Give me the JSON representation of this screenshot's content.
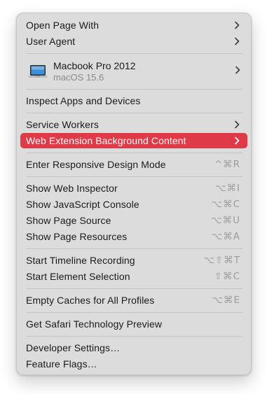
{
  "menu": {
    "open_page_with": "Open Page With",
    "user_agent": "User Agent",
    "device": {
      "name": "Macbook Pro 2012",
      "os": "macOS 15.6"
    },
    "inspect_apps": "Inspect Apps and Devices",
    "service_workers": "Service Workers",
    "web_extension_bg": "Web Extension Background Content",
    "responsive_mode": {
      "label": "Enter Responsive Design Mode",
      "shortcut": "^⌘R"
    },
    "web_inspector": {
      "label": "Show Web Inspector",
      "shortcut": "⌥⌘I"
    },
    "js_console": {
      "label": "Show JavaScript Console",
      "shortcut": "⌥⌘C"
    },
    "page_source": {
      "label": "Show Page Source",
      "shortcut": "⌥⌘U"
    },
    "page_resources": {
      "label": "Show Page Resources",
      "shortcut": "⌥⌘A"
    },
    "timeline": {
      "label": "Start Timeline Recording",
      "shortcut": "⌥⇧⌘T"
    },
    "element_selection": {
      "label": "Start Element Selection",
      "shortcut": "⇧⌘C"
    },
    "empty_caches": {
      "label": "Empty Caches for All Profiles",
      "shortcut": "⌥⌘E"
    },
    "get_stp": "Get Safari Technology Preview",
    "developer_settings": "Developer Settings…",
    "feature_flags": "Feature Flags…"
  },
  "colors": {
    "menu_bg": "#dcdcdc",
    "selected_bg": "#de3a47",
    "shortcut_text": "#9d9d9d"
  },
  "icons": [
    "chevron-right-icon",
    "laptop-icon"
  ]
}
